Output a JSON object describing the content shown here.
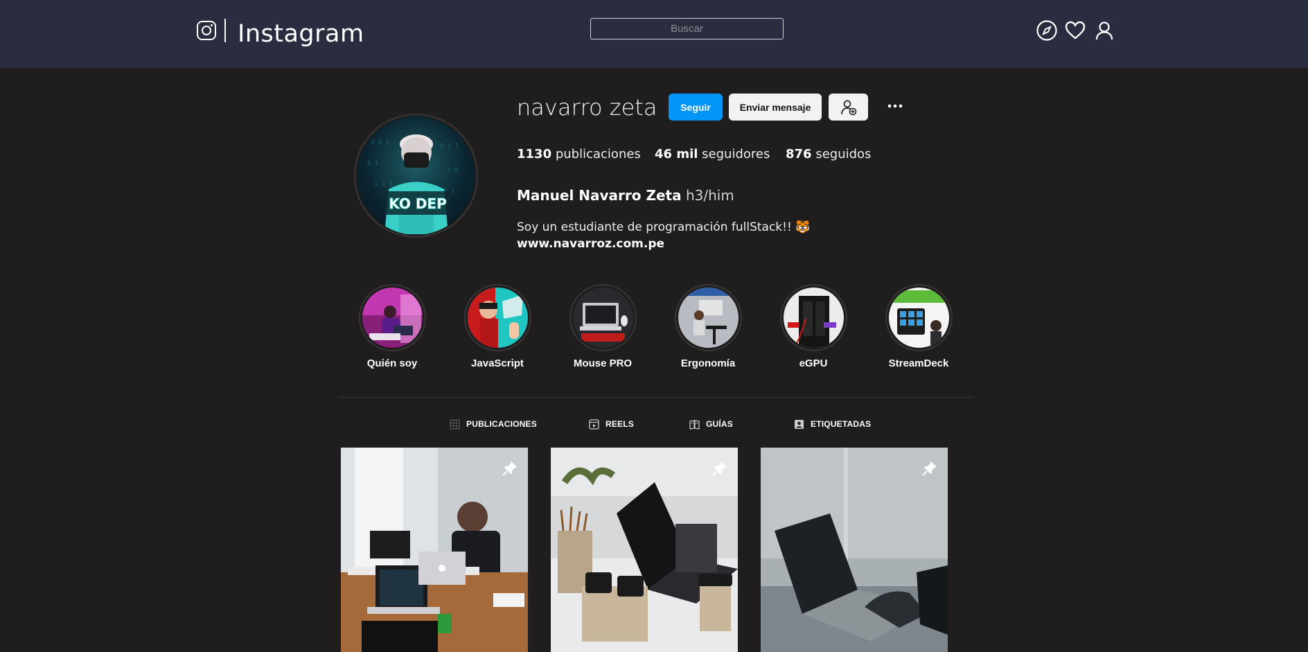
{
  "header": {
    "logo_text": "Instagram",
    "search_placeholder": "Buscar",
    "icons": [
      "instagram-icon",
      "compass-icon",
      "heart-icon",
      "user-icon"
    ]
  },
  "profile": {
    "username": "navarro zeta",
    "follow_label": "Seguir",
    "message_label": "Enviar mensaje",
    "stats": {
      "posts_count": "1130",
      "posts_label": "publicaciones",
      "followers_count": "46 mil",
      "followers_label": "seguidores",
      "following_count": "876",
      "following_label": "seguidos"
    },
    "full_name": "Manuel Navarro Zeta",
    "pronouns": "h3/him",
    "bio": "Soy un estudiante de programación fullStack!! 🐯",
    "website": "www.navarroz.com.pe"
  },
  "highlights": [
    {
      "label": "Quién soy"
    },
    {
      "label": "JavaScript"
    },
    {
      "label": "Mouse PRO"
    },
    {
      "label": "Ergonomía"
    },
    {
      "label": "eGPU"
    },
    {
      "label": "StreamDeck"
    }
  ],
  "tabs": [
    {
      "label": "PUBLICACIONES"
    },
    {
      "label": "REELS"
    },
    {
      "label": "GUÍAS"
    },
    {
      "label": "ETIQUETADAS"
    }
  ],
  "colors": {
    "header_bg": "#2a2d3f",
    "page_bg": "#1f1d1e",
    "follow_button": "#0095f6"
  }
}
